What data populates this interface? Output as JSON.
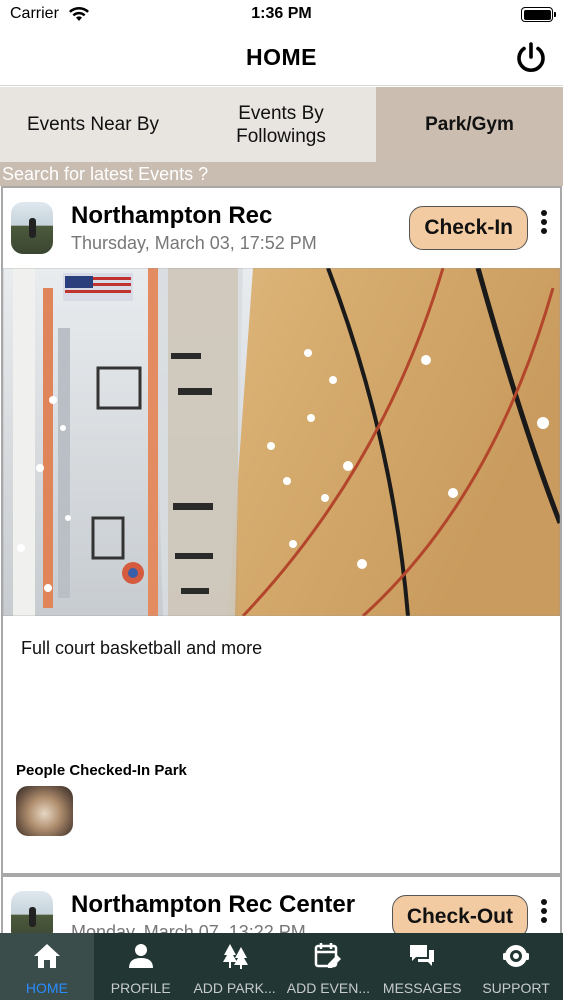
{
  "status_bar": {
    "carrier": "Carrier",
    "time": "1:36 PM"
  },
  "header": {
    "title": "HOME"
  },
  "tabs": [
    {
      "label": "Events Near By"
    },
    {
      "label": "Events By\nFollowings"
    },
    {
      "label": "Park/Gym"
    }
  ],
  "search": {
    "placeholder": "Search for latest Events ?"
  },
  "cards": [
    {
      "title": "Northampton Rec",
      "date": "Thursday, March 03, 17:52 PM",
      "button": "Check-In",
      "description": "Full court basketball and more",
      "people_label": "People Checked-In Park"
    },
    {
      "title": "Northampton Rec Center",
      "date": "Monday, March 07, 13:22 PM",
      "button": "Check-Out"
    }
  ],
  "tabbar": [
    {
      "label": "HOME",
      "icon": "home-icon"
    },
    {
      "label": "PROFILE",
      "icon": "person-icon"
    },
    {
      "label": "ADD PARK...",
      "icon": "trees-icon"
    },
    {
      "label": "ADD EVEN...",
      "icon": "calendar-edit-icon"
    },
    {
      "label": "MESSAGES",
      "icon": "chat-icon"
    },
    {
      "label": "SUPPORT",
      "icon": "support-icon"
    }
  ],
  "colors": {
    "tab_bg": "#e8e4e0",
    "tab_selected_bg": "#cbbeb1",
    "button_bg": "#f3cba2",
    "tabbar_bg": "#223634",
    "tabbar_active": "#2a8cff"
  }
}
